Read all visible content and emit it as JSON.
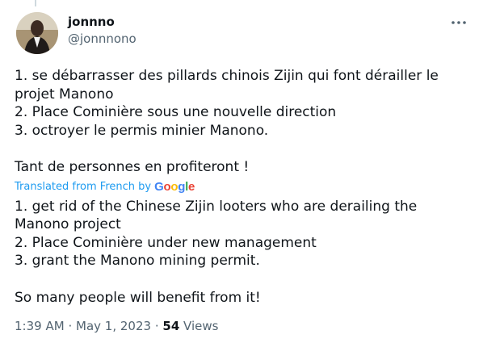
{
  "author": {
    "display_name": "jonnno",
    "handle": "@jonnnono",
    "avatar_icon": "profile-photo"
  },
  "tweet": {
    "original_lines": [
      "1. se débarrasser des pillards chinois Zijin qui font dérailler le projet Manono",
      "2. Place Cominière sous une nouvelle direction",
      "3. octroyer le permis minier Manono.",
      "Tant de personnes en profiteront !"
    ],
    "translation_label": "Translated from French by",
    "translation_provider": "Google",
    "translated_lines": [
      "1. get rid of the Chinese Zijin looters who are derailing the Manono project",
      "2. Place Cominière under new management",
      "3. grant the Manono mining permit.",
      "So many people will benefit from it!"
    ]
  },
  "meta": {
    "time": "1:39 AM",
    "separator": "·",
    "date": "May 1, 2023",
    "views_count": "54",
    "views_label": "Views"
  },
  "colors": {
    "text": "#0f1419",
    "secondary": "#536471",
    "link": "#1d9bf0"
  }
}
